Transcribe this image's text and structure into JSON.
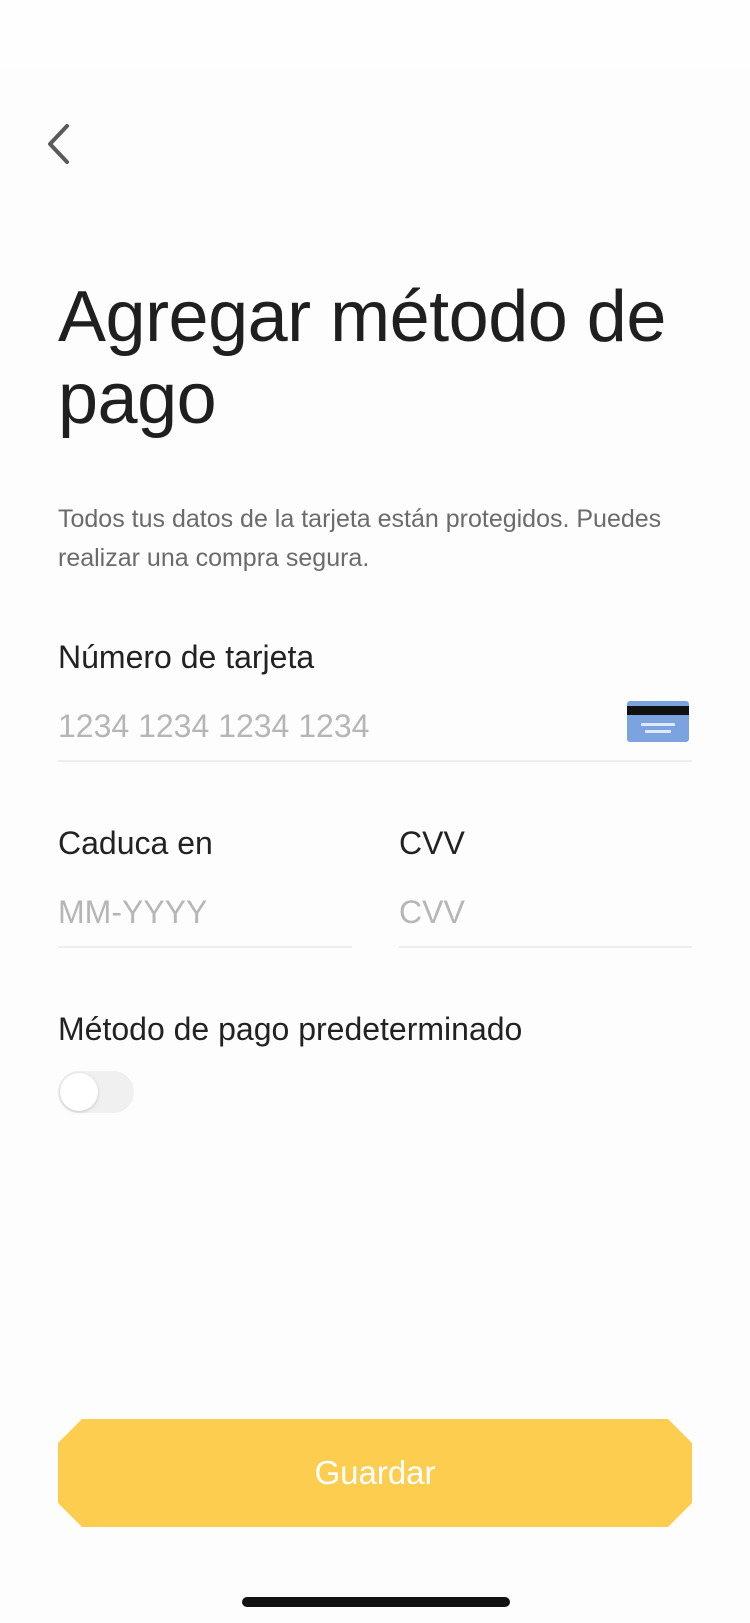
{
  "header": {
    "back_icon": "chevron-left-icon"
  },
  "page": {
    "title": "Agregar método de pago",
    "subtitle": "Todos tus datos de la tarjeta están protegidos. Puedes realizar una compra segura."
  },
  "card_number": {
    "label": "Número de tarjeta",
    "value": "",
    "placeholder": "1234 1234 1234 1234",
    "icon": "credit-card-icon"
  },
  "expiry": {
    "label": "Caduca en",
    "value": "",
    "placeholder": "MM-YYYY"
  },
  "cvv": {
    "label": "CVV",
    "value": "",
    "placeholder": "CVV"
  },
  "default_method": {
    "label": "Método de pago predeterminado",
    "enabled": false
  },
  "actions": {
    "save_label": "Guardar"
  },
  "colors": {
    "accent": "#fccd4f",
    "card_icon": "#7ba3e0",
    "card_stripe": "#111111"
  }
}
